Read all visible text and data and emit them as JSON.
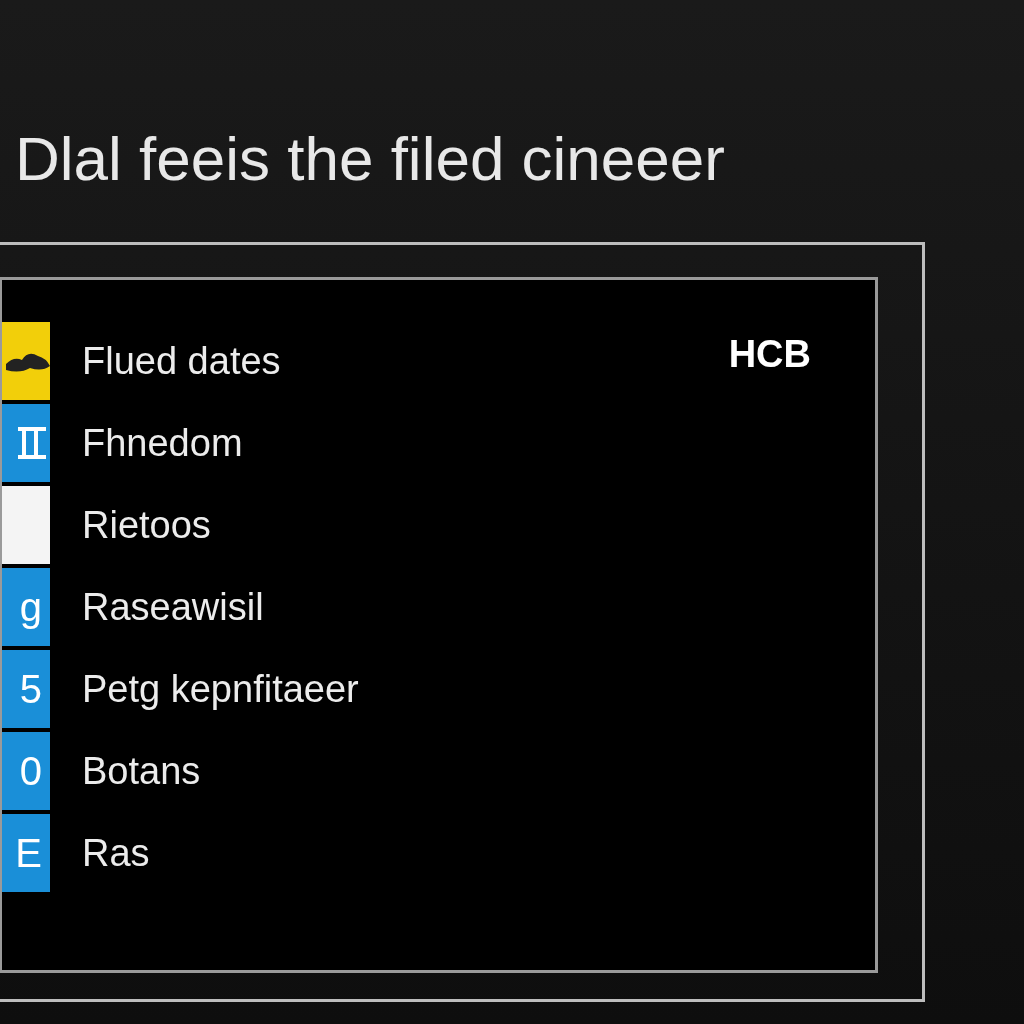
{
  "heading": "Dlal feeis the filed cineeer",
  "badge": "HCB",
  "items": [
    {
      "label": "Flued dates",
      "kind": "icon",
      "color": "#f2cf0a"
    },
    {
      "label": "Fhnedom",
      "kind": "icon",
      "color": "#1a8fd8"
    },
    {
      "label": "Rietoos",
      "kind": "blank",
      "color": "#f4f4f4"
    },
    {
      "label": "Raseawisil",
      "kind": "glyph",
      "glyph": "g",
      "color": "#1a8fd8"
    },
    {
      "label": "Petg kepnfitaeer",
      "kind": "glyph",
      "glyph": "5",
      "color": "#1a8fd8"
    },
    {
      "label": "Botans",
      "kind": "glyph",
      "glyph": "0",
      "color": "#1a8fd8"
    },
    {
      "label": "Ras",
      "kind": "glyph",
      "glyph": "E",
      "color": "#1a8fd8"
    }
  ]
}
